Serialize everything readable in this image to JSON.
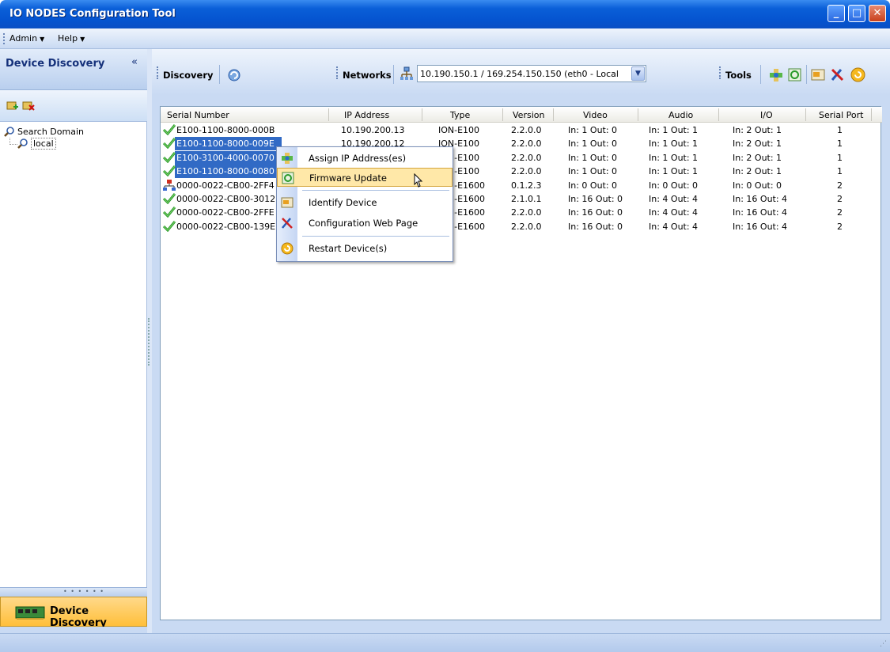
{
  "window": {
    "title": "IO NODES  Configuration Tool"
  },
  "menu": {
    "admin": "Admin",
    "help": "Help"
  },
  "left_panel": {
    "title": "Device Discovery",
    "tree_root": "Search Domain",
    "tree_child": "local",
    "nav_button": "Device Discovery"
  },
  "toolbar": {
    "discovery_label": "Discovery",
    "networks_label": "Networks",
    "network_value": "10.190.150.1 / 169.254.150.150 (eth0 - Local",
    "tools_label": "Tools"
  },
  "table": {
    "columns": [
      "Serial Number",
      "IP Address",
      "Type",
      "Version",
      "Video",
      "Audio",
      "I/O",
      "Serial Port"
    ],
    "rows": [
      {
        "serial": "E100-1100-8000-000B",
        "ip": "10.190.200.13",
        "type": "ION-E100",
        "version": "2.2.0.0",
        "video": "In: 1   Out: 0",
        "audio": "In: 1   Out: 1",
        "io": "In: 2   Out: 1",
        "port": "1",
        "status": "ok",
        "selected": false
      },
      {
        "serial": "E100-1100-8000-009E",
        "ip": "10.190.200.12",
        "type": "ION-E100",
        "version": "2.2.0.0",
        "video": "In: 1   Out: 0",
        "audio": "In: 1   Out: 1",
        "io": "In: 2   Out: 1",
        "port": "1",
        "status": "ok",
        "selected": true
      },
      {
        "serial": "E100-3100-4000-0070",
        "ip": "",
        "type": "ION-E100",
        "version": "2.2.0.0",
        "video": "In: 1   Out: 0",
        "audio": "In: 1   Out: 1",
        "io": "In: 2   Out: 1",
        "port": "1",
        "status": "ok",
        "selected": true
      },
      {
        "serial": "E100-1100-8000-0080",
        "ip": "",
        "type": "ION-E100",
        "version": "2.2.0.0",
        "video": "In: 1   Out: 0",
        "audio": "In: 1   Out: 1",
        "io": "In: 2   Out: 1",
        "port": "1",
        "status": "ok",
        "selected": true
      },
      {
        "serial": "0000-0022-CB00-2FF4",
        "ip": "",
        "type": "ION-E1600",
        "version": "0.1.2.3",
        "video": "In: 0   Out: 0",
        "audio": "In: 0   Out: 0",
        "io": "In: 0   Out: 0",
        "port": "2",
        "status": "network",
        "selected": false
      },
      {
        "serial": "0000-0022-CB00-3012",
        "ip": "",
        "type": "ION-E1600",
        "version": "2.1.0.1",
        "video": "In: 16   Out: 0",
        "audio": "In: 4   Out: 4",
        "io": "In: 16   Out: 4",
        "port": "2",
        "status": "ok",
        "selected": false
      },
      {
        "serial": "0000-0022-CB00-2FFE",
        "ip": "",
        "type": "ION-E1600",
        "version": "2.2.0.0",
        "video": "In: 16   Out: 0",
        "audio": "In: 4   Out: 4",
        "io": "In: 16   Out: 4",
        "port": "2",
        "status": "ok",
        "selected": false
      },
      {
        "serial": "0000-0022-CB00-139E",
        "ip": "",
        "type": "ION-E1600",
        "version": "2.2.0.0",
        "video": "In: 16   Out: 0",
        "audio": "In: 4   Out: 4",
        "io": "In: 16   Out: 4",
        "port": "2",
        "status": "ok",
        "selected": false
      }
    ]
  },
  "context_menu": {
    "items": [
      {
        "label": "Assign IP Address(es)",
        "icon": "assign-ip-icon"
      },
      {
        "label": "Firmware Update",
        "icon": "firmware-update-icon",
        "highlighted": true
      },
      {
        "label": "Identify Device",
        "icon": "identify-device-icon"
      },
      {
        "label": "Configuration Web Page",
        "icon": "tools-icon"
      },
      {
        "label": "Restart Device(s)",
        "icon": "restart-icon"
      }
    ]
  },
  "colors": {
    "selection": "#316ac5",
    "titlebar": "#0554d0",
    "highlight": "#ffe8a8"
  }
}
